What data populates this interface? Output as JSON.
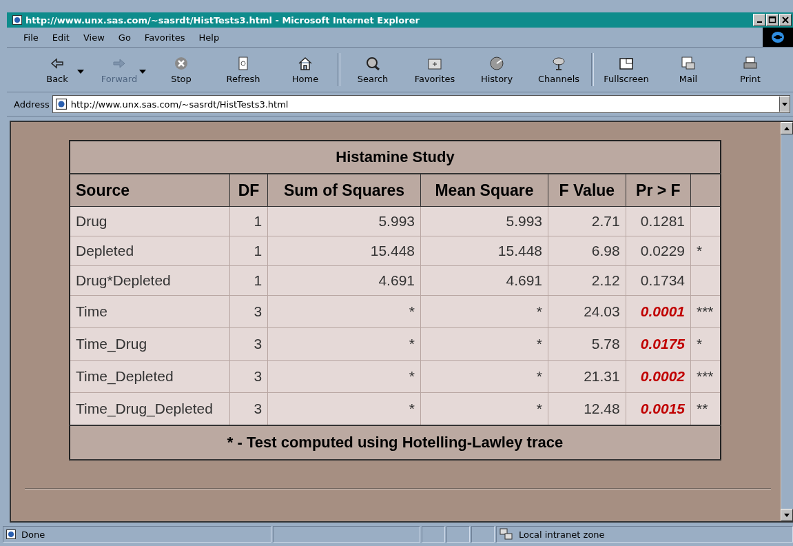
{
  "window": {
    "title": "http://www.unx.sas.com/~sasrdt/HistTests3.html - Microsoft Internet Explorer"
  },
  "menu": [
    "File",
    "Edit",
    "View",
    "Go",
    "Favorites",
    "Help"
  ],
  "toolbar": [
    {
      "label": "Back",
      "kind": "back",
      "disabled": false,
      "dropdown": true
    },
    {
      "label": "Forward",
      "kind": "forward",
      "disabled": true,
      "dropdown": true
    },
    {
      "label": "Stop",
      "kind": "stop",
      "disabled": false,
      "dropdown": false
    },
    {
      "label": "Refresh",
      "kind": "refresh",
      "disabled": false,
      "dropdown": false
    },
    {
      "label": "Home",
      "kind": "home",
      "disabled": false,
      "dropdown": false
    },
    {
      "label": "Search",
      "kind": "search",
      "disabled": false,
      "dropdown": false
    },
    {
      "label": "Favorites",
      "kind": "favorites",
      "disabled": false,
      "dropdown": false
    },
    {
      "label": "History",
      "kind": "history",
      "disabled": false,
      "dropdown": false
    },
    {
      "label": "Channels",
      "kind": "channels",
      "disabled": false,
      "dropdown": false
    },
    {
      "label": "Fullscreen",
      "kind": "fullscreen",
      "disabled": false,
      "dropdown": false
    },
    {
      "label": "Mail",
      "kind": "mail",
      "disabled": false,
      "dropdown": false
    },
    {
      "label": "Print",
      "kind": "print",
      "disabled": false,
      "dropdown": false
    }
  ],
  "address": {
    "label": "Address",
    "value": "http://www.unx.sas.com/~sasrdt/HistTests3.html"
  },
  "table": {
    "title": "Histamine Study",
    "columns": [
      "Source",
      "DF",
      "Sum of Squares",
      "Mean Square",
      "F Value",
      "Pr > F"
    ],
    "rows": [
      {
        "source": "Drug",
        "df": "1",
        "ss": "5.993",
        "ms": "5.993",
        "f": "2.71",
        "p": "0.1281",
        "significant": false
      },
      {
        "source": "Depleted",
        "df": "1",
        "ss": "15.448",
        "ms": "15.448",
        "f": "6.98",
        "p": "0.0229",
        "significant": false,
        "flag": "*"
      },
      {
        "source": "Drug*Depleted",
        "df": "1",
        "ss": "4.691",
        "ms": "4.691",
        "f": "2.12",
        "p": "0.1734",
        "significant": false
      },
      {
        "source": "Time",
        "df": "3",
        "ss": "*",
        "ms": "*",
        "f": "24.03",
        "p": "0.0001",
        "significant": true,
        "flag": "***"
      },
      {
        "source": "Time_Drug",
        "df": "3",
        "ss": "*",
        "ms": "*",
        "f": "5.78",
        "p": "0.0175",
        "significant": true,
        "flag": "*"
      },
      {
        "source": "Time_Depleted",
        "df": "3",
        "ss": "*",
        "ms": "*",
        "f": "21.31",
        "p": "0.0002",
        "significant": true,
        "flag": "***"
      },
      {
        "source": "Time_Drug_Depleted",
        "df": "3",
        "ss": "*",
        "ms": "*",
        "f": "12.48",
        "p": "0.0015",
        "significant": true,
        "flag": "**"
      }
    ],
    "footnote": "* - Test computed using Hotelling-Lawley trace"
  },
  "status_bar": {
    "text": "Done",
    "zone": "Local intranet zone"
  }
}
